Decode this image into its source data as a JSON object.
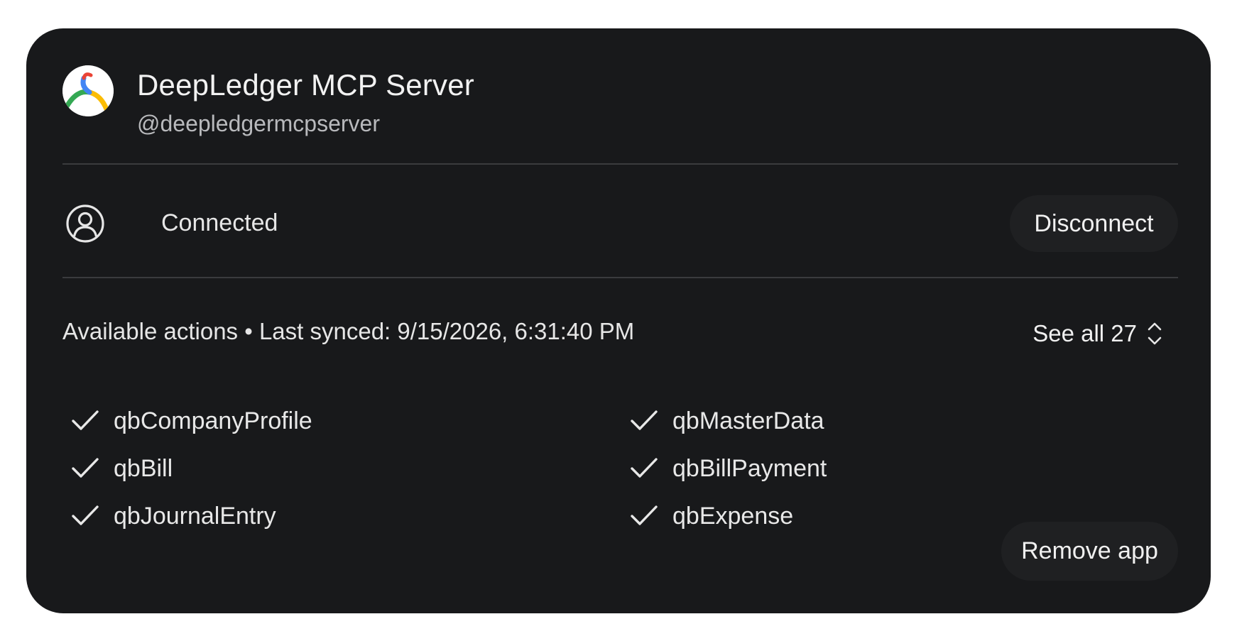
{
  "app": {
    "title": "DeepLedger MCP Server",
    "handle": "@deepledgermcpserver",
    "logo_icon": "deepledger-logo-icon"
  },
  "connection": {
    "status": "Connected",
    "status_icon": "person-circle-icon",
    "disconnect_label": "Disconnect"
  },
  "actions": {
    "header_label": "Available actions • Last synced: 9/15/2026, 6:31:40 PM",
    "see_all_label": "See all 27",
    "see_all_icon": "expand-updown-icon",
    "items": [
      {
        "label": "qbCompanyProfile",
        "enabled": true
      },
      {
        "label": "qbMasterData",
        "enabled": true
      },
      {
        "label": "qbBill",
        "enabled": true
      },
      {
        "label": "qbBillPayment",
        "enabled": true
      },
      {
        "label": "qbJournalEntry",
        "enabled": true
      },
      {
        "label": "qbExpense",
        "enabled": true
      }
    ]
  },
  "footer": {
    "remove_label": "Remove app"
  },
  "colors": {
    "card_background": "#18191b",
    "button_background": "#1f2022",
    "text_primary": "#f2f2f2",
    "text_secondary": "#b9babd",
    "divider": "#3a3b3e",
    "logo_blue": "#4285f4",
    "logo_green": "#34a853",
    "logo_yellow": "#fbbc04",
    "logo_red": "#ea4335"
  }
}
